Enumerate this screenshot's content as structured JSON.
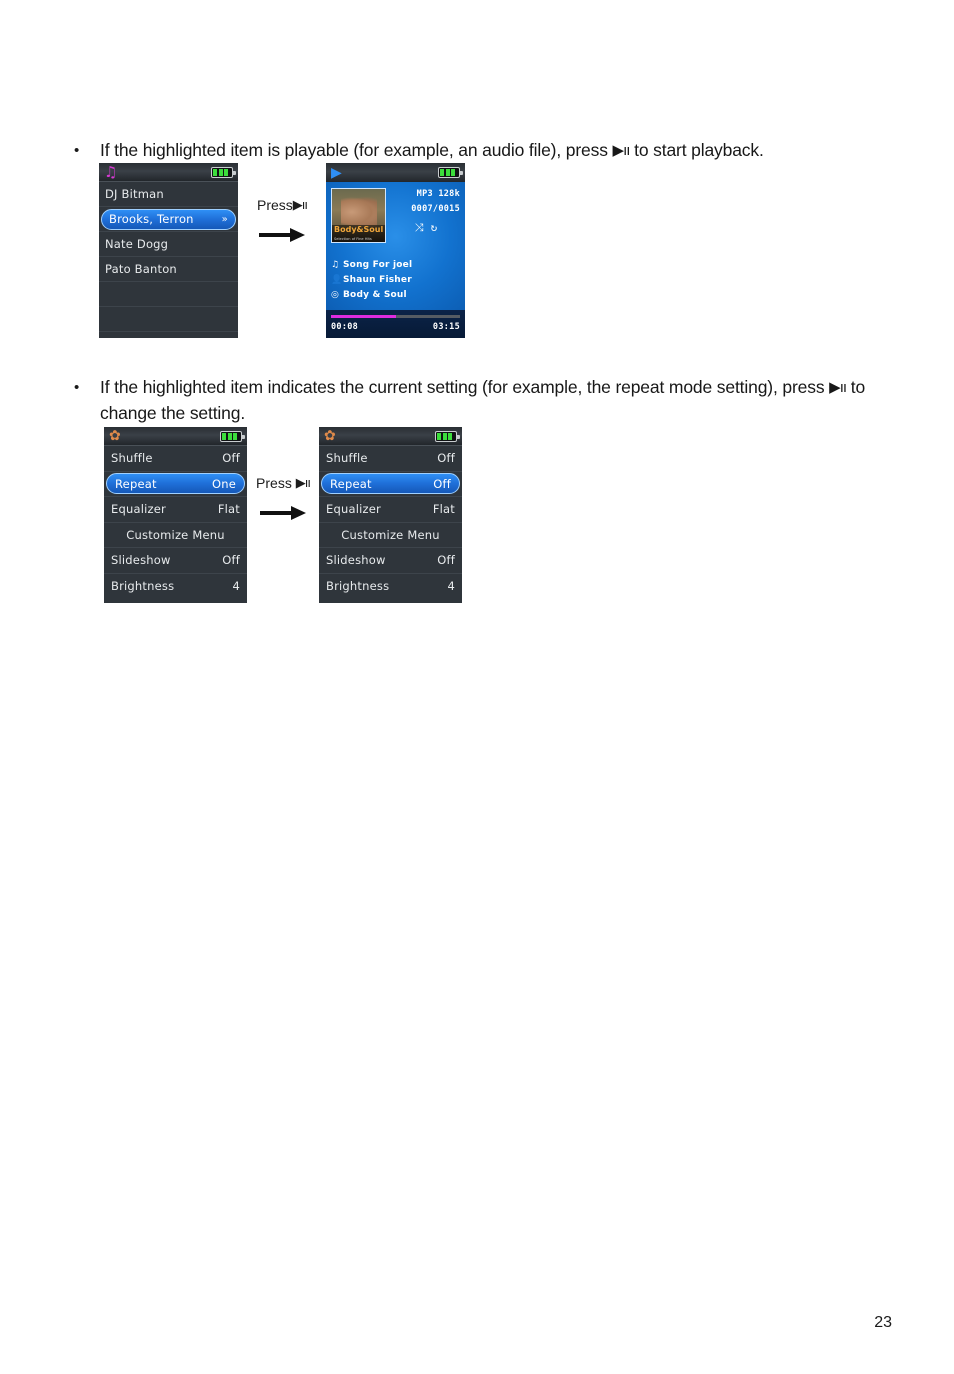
{
  "page": {
    "number": "23"
  },
  "bullets": [
    {
      "marker": "•",
      "text_before": "If the highlighted item is playable (for example, an audio file), press ",
      "glyph": "▶ıı",
      "text_after": " to start playback."
    },
    {
      "marker": "•",
      "text_before": "If the highlighted item indicates the current setting (for example, the repeat mode setting), press ",
      "glyph": "▶ıı",
      "text_after": " to change the setting."
    }
  ],
  "figure_one": {
    "press_label_before": "Press",
    "press_label_glyph": "▶ıı",
    "arrow": "right-arrow",
    "list_screen": {
      "titlebar_icon": "music-note-icon",
      "titlebar_icon_glyph": "♫",
      "battery_icon": "battery-icon",
      "items": [
        {
          "label": "DJ Bitman",
          "selected": false,
          "chevron": ""
        },
        {
          "label": "Brooks, Terron",
          "selected": true,
          "chevron": "»"
        },
        {
          "label": "Nate Dogg",
          "selected": false,
          "chevron": ""
        },
        {
          "label": "Pato Banton",
          "selected": false,
          "chevron": ""
        },
        {
          "label": "",
          "selected": false,
          "chevron": ""
        },
        {
          "label": "",
          "selected": false,
          "chevron": ""
        }
      ]
    },
    "now_playing_screen": {
      "titlebar_icon": "play-icon",
      "titlebar_icon_glyph": "▶",
      "battery_icon": "battery-icon",
      "album_art_title": "Body&Soul",
      "album_art_subtitle": "Selection of Fine Hits",
      "format": "MP3  128k",
      "track_counter": "0007/0015",
      "shuffle_icon_glyph": "⤨",
      "repeat_icon_glyph": "↻",
      "song_icon_glyph": "♫",
      "song": "Song For joel",
      "artist_icon_glyph": "👤",
      "artist": "Shaun Fisher",
      "album_icon_glyph": "◎",
      "album": "Body & Soul",
      "elapsed": "00:08",
      "total": "03:15",
      "progress_percent": 50
    }
  },
  "figure_two": {
    "press_label_before": "Press ",
    "press_label_glyph": "▶ıı",
    "arrow": "right-arrow",
    "settings_before": {
      "titlebar_icon": "gear-icon",
      "titlebar_icon_glyph": "✿",
      "battery_icon": "battery-icon",
      "items": [
        {
          "label": "Shuffle",
          "value": "Off",
          "selected": false
        },
        {
          "label": "Repeat",
          "value": "One",
          "selected": true
        },
        {
          "label": "Equalizer",
          "value": "Flat",
          "selected": false
        },
        {
          "label": "Customize Menu",
          "value": "",
          "selected": false
        },
        {
          "label": "Slideshow",
          "value": "Off",
          "selected": false
        },
        {
          "label": "Brightness",
          "value": "4",
          "selected": false
        }
      ]
    },
    "settings_after": {
      "titlebar_icon": "gear-icon",
      "titlebar_icon_glyph": "✿",
      "battery_icon": "battery-icon",
      "items": [
        {
          "label": "Shuffle",
          "value": "Off",
          "selected": false
        },
        {
          "label": "Repeat",
          "value": "Off",
          "selected": true
        },
        {
          "label": "Equalizer",
          "value": "Flat",
          "selected": false
        },
        {
          "label": "Customize Menu",
          "value": "",
          "selected": false
        },
        {
          "label": "Slideshow",
          "value": "Off",
          "selected": false
        },
        {
          "label": "Brightness",
          "value": "4",
          "selected": false
        }
      ]
    }
  },
  "colors": {
    "selection_blue": "#2f8ff5",
    "screen_background": "#2f353b",
    "now_playing_blue": "#1272cf",
    "progress_magenta": "#e02ce0",
    "note_icon_magenta": "#d33ad0",
    "gear_icon_orange": "#e08a4a",
    "battery_green": "#3cdd3c"
  }
}
